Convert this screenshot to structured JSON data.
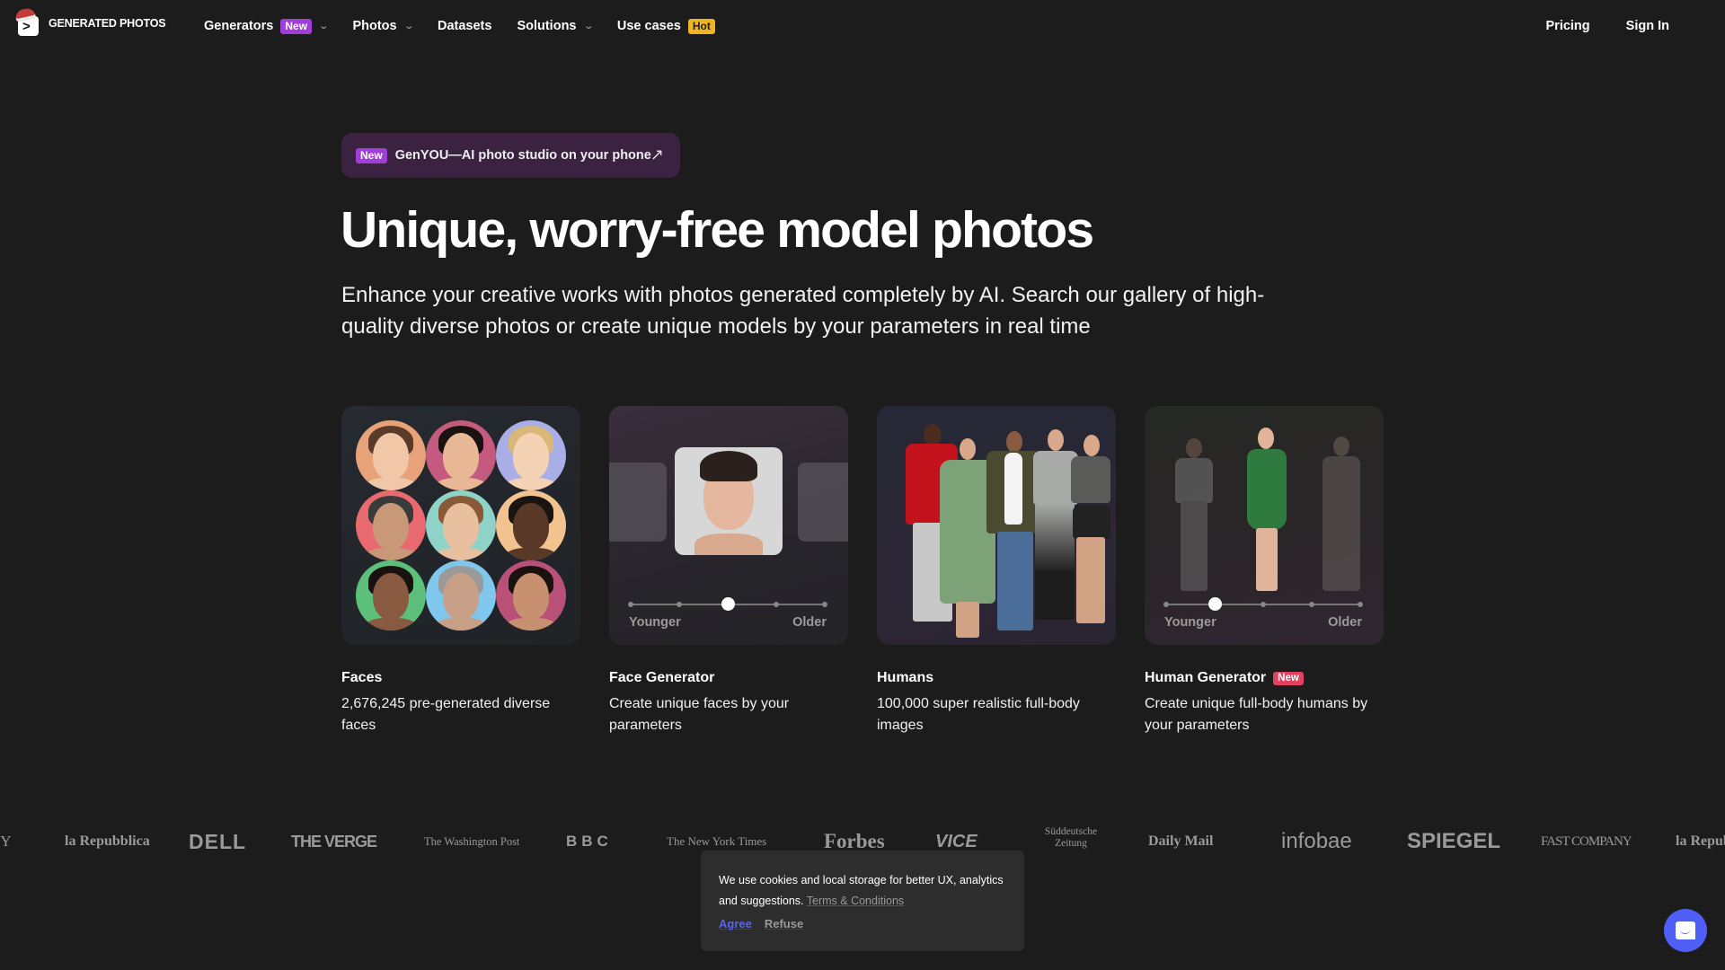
{
  "nav": {
    "logo_text": "GENERATED PHOTOS",
    "items": [
      {
        "label": "Generators",
        "badge": "New",
        "has_dropdown": true
      },
      {
        "label": "Photos",
        "badge": null,
        "has_dropdown": true
      },
      {
        "label": "Datasets",
        "badge": null,
        "has_dropdown": false
      },
      {
        "label": "Solutions",
        "badge": null,
        "has_dropdown": true
      },
      {
        "label": "Use cases",
        "badge": "Hot",
        "has_dropdown": false
      }
    ],
    "right": {
      "pricing": "Pricing",
      "sign_in": "Sign In"
    }
  },
  "promo": {
    "badge": "New",
    "text": "GenYOU—AI photo studio on your phone",
    "icon": "arrow-up-right-icon"
  },
  "hero": {
    "title": "Unique, worry-free model photos",
    "subtitle": "Enhance your creative works with photos generated completely by AI. Search our gallery of high-quality diverse photos or create unique models by your parameters in real time"
  },
  "cards": [
    {
      "title": "Faces",
      "badge": null,
      "description": "2,676,245 pre-generated diverse faces"
    },
    {
      "title": "Face Generator",
      "badge": null,
      "description": "Create unique faces by your parameters",
      "slider": {
        "min_label": "Younger",
        "max_label": "Older",
        "steps": 5,
        "value_step": 3
      }
    },
    {
      "title": "Humans",
      "badge": null,
      "description": "100,000 super realistic full-body images"
    },
    {
      "title": "Human Generator",
      "badge": "New",
      "description": "Create unique full-body humans by your parameters",
      "slider": {
        "min_label": "Younger",
        "max_label": "Older",
        "steps": 5,
        "value_step": 2
      }
    }
  ],
  "face_circle_colors": [
    "#e8a27a",
    "#c45a7e",
    "#a9aee6",
    "#e86a70",
    "#8fd3c8",
    "#f2c38e",
    "#5cc07a",
    "#7fc7ec",
    "#b85078"
  ],
  "press_logos": [
    "NY",
    "la Repubblica",
    "DELL",
    "THE VERGE",
    "The Washington Post",
    "BBC",
    "The New York Times",
    "Forbes",
    "VICE",
    "Süddeutsche Zeitung",
    "Daily Mail",
    "infobae",
    "SPIEGEL",
    "FAST COMPANY",
    "la Repubblica"
  ],
  "cookie": {
    "text": "We use cookies and local storage for better UX, analytics and suggestions.",
    "link": "Terms & Conditions",
    "agree": "Agree",
    "refuse": "Refuse"
  },
  "chat": {
    "icon": "chat-icon"
  },
  "colors": {
    "background": "#1c1c1c",
    "badge_new": "#a13dd9",
    "badge_hot": "#f0b323",
    "badge_red": "#e2425f",
    "accent_blue": "#4f5ef7"
  }
}
